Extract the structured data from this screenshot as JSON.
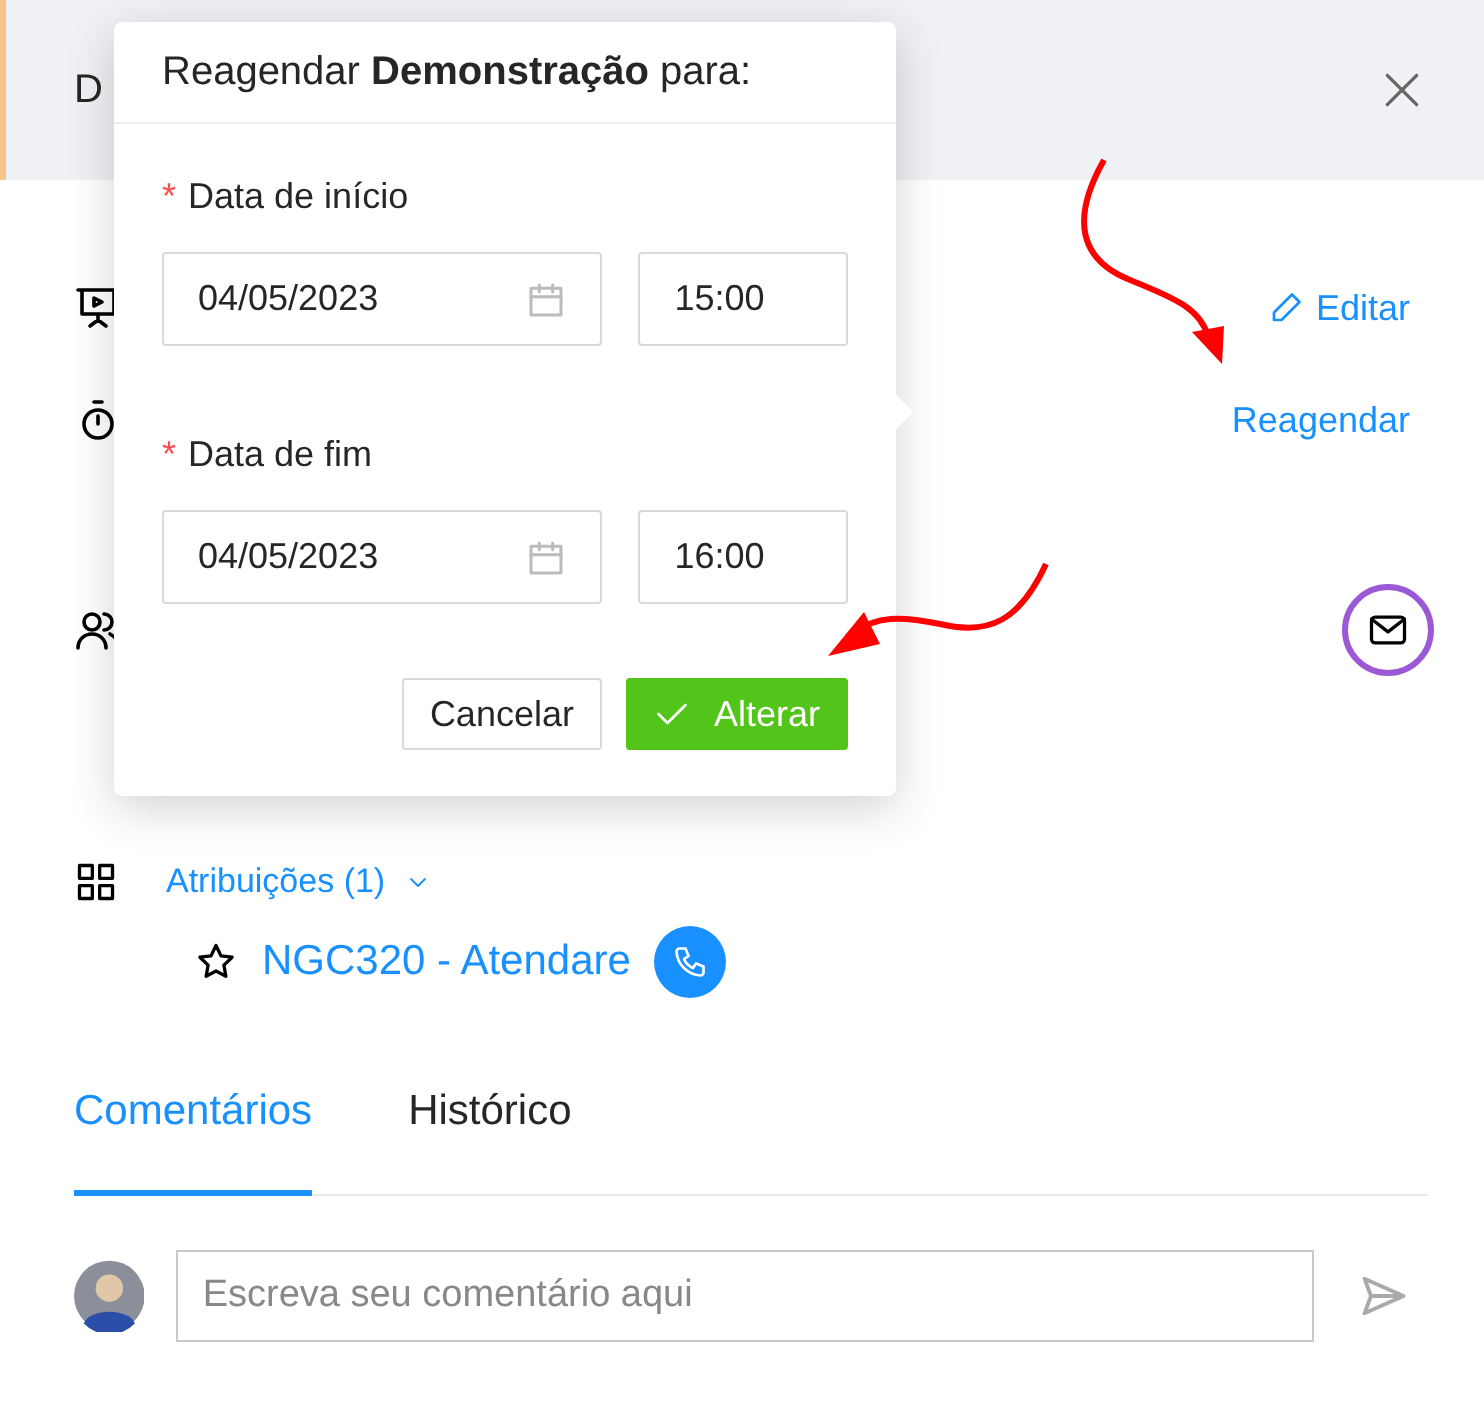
{
  "drawer": {
    "title": "D",
    "actions": [
      {
        "label": "Editar",
        "kind": "edit"
      },
      {
        "label": "Reagendar",
        "kind": "plain"
      }
    ],
    "assignments": {
      "label": "Atribuições (1)",
      "items": [
        {
          "name": "NGC320 - Atendare"
        }
      ]
    },
    "tabs": [
      {
        "label": "Comentários",
        "selected": true
      },
      {
        "label": "Histórico",
        "selected": false
      }
    ],
    "comment": {
      "placeholder": "Escreva seu comentário aqui"
    }
  },
  "popover": {
    "title": "Reagendar **Demonstração** para:",
    "fields": [
      {
        "label": "Data de início",
        "required_mark": "*",
        "date": "04/05/2023",
        "time": "15:00"
      },
      {
        "label": "Data de fim",
        "required_mark": "*",
        "date": "04/05/2023",
        "time": "16:00"
      }
    ],
    "buttons": [
      {
        "label": "Cancelar",
        "kind": "secondary"
      },
      {
        "label": "Alterar",
        "kind": "primary"
      }
    ]
  }
}
